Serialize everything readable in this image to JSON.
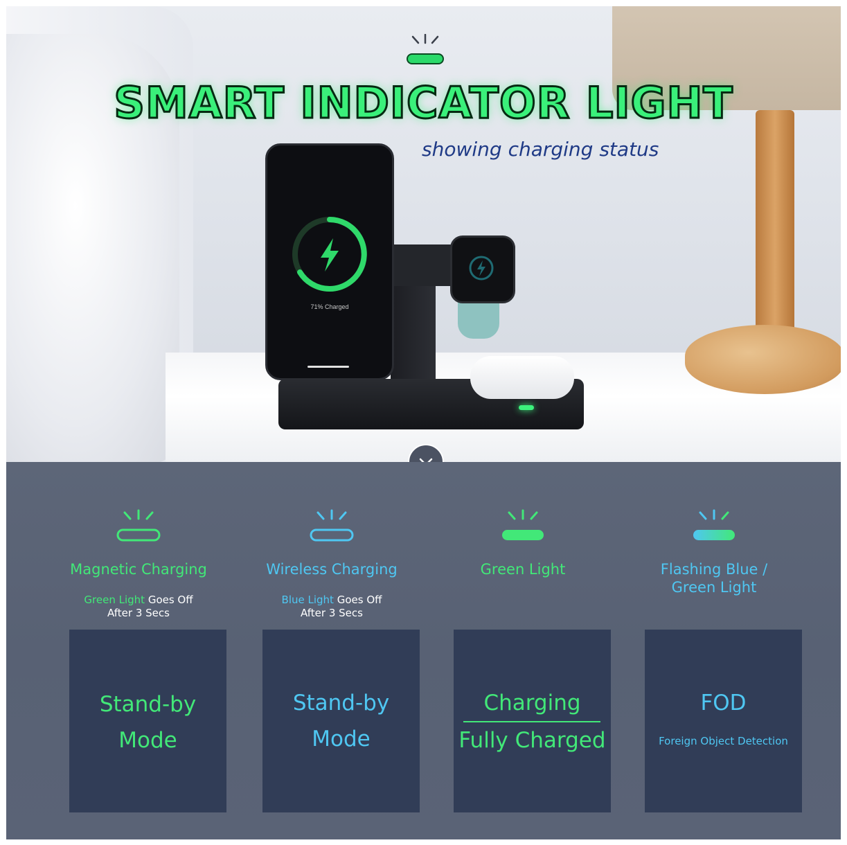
{
  "hero": {
    "title": "SMART INDICATOR LIGHT",
    "subtitle": "showing charging status",
    "phone_caption": "71% Charged"
  },
  "colors": {
    "green": "#42e878",
    "cyan": "#4fc7f2",
    "panel": "#5c6678",
    "card": "#313d57",
    "subtitle": "#1f3a86"
  },
  "modes": [
    {
      "label": "Magnetic Charging",
      "light_color": "green",
      "light_state": "outline",
      "desc_highlight": "Green Light",
      "desc_rest": " Goes Off",
      "desc_line2": "After 3 Secs",
      "card_lines": [
        "Stand-by",
        "Mode"
      ]
    },
    {
      "label": "Wireless Charging",
      "light_color": "cyan",
      "light_state": "outline",
      "desc_highlight": "Blue Light",
      "desc_rest": " Goes Off",
      "desc_line2": "After 3 Secs",
      "card_lines": [
        "Stand-by",
        "Mode"
      ]
    },
    {
      "label": "Green Light",
      "light_color": "green",
      "light_state": "solid",
      "card_lines": [
        "Charging",
        "Fully Charged"
      ]
    },
    {
      "label_line1": "Flashing Blue /",
      "label_line2": "Green Light",
      "light_color": "cyan-green",
      "light_state": "solid",
      "card_title": "FOD",
      "card_note": "Foreign Object Detection"
    }
  ],
  "icons": [
    "indicator-light-icon",
    "lightning-bolt-icon",
    "chevron-down-icon"
  ]
}
